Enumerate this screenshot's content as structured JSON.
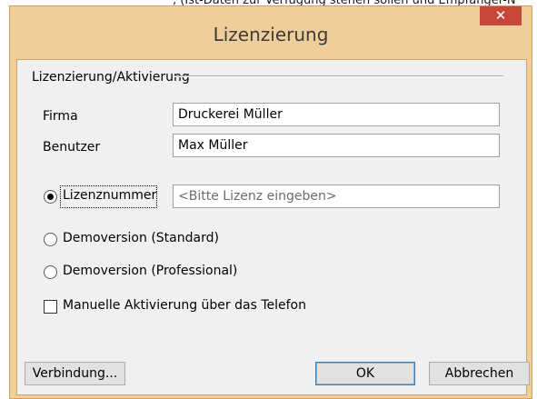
{
  "background": {
    "partial_text": ", (Ist-Daten zur Verfügung stehen sollen und Empfänger-N"
  },
  "window": {
    "title": "Lizenzierung",
    "close_glyph": "✕"
  },
  "group": {
    "label": "Lizenzierung/Aktivierung"
  },
  "fields": {
    "firma_label": "Firma",
    "firma_value": "Druckerei Müller",
    "benutzer_label": "Benutzer",
    "benutzer_value": "Max Müller"
  },
  "options": {
    "lizenznummer_label": "Lizenznummer",
    "lizenznummer_placeholder": "<Bitte Lizenz eingeben>",
    "demo_standard_label": "Demoversion (Standard)",
    "demo_professional_label": "Demoversion (Professional)",
    "selected": "lizenznummer"
  },
  "checkbox": {
    "manual_activation_label": "Manuelle Aktivierung über das Telefon",
    "checked": false
  },
  "buttons": {
    "connection_label": "Verbindung...",
    "ok_label": "OK",
    "cancel_label": "Abbrechen"
  },
  "colors": {
    "frame": "#f0ce9c",
    "close_button": "#c7483a",
    "client_area": "#f0f0f0"
  }
}
